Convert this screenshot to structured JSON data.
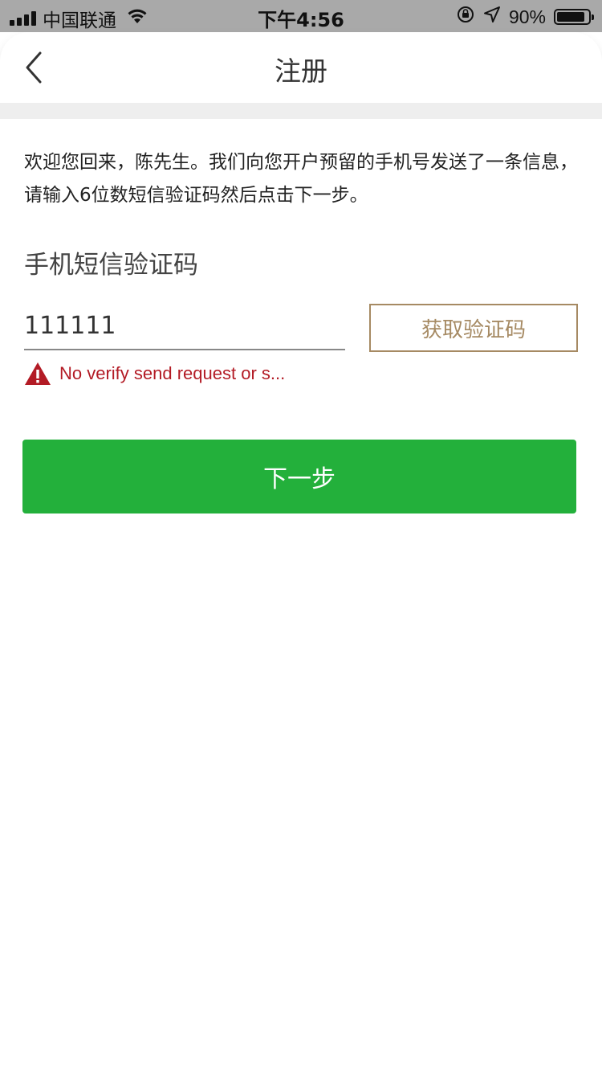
{
  "status_bar": {
    "carrier": "中国联通",
    "time": "下午4:56",
    "battery": "90%",
    "battery_level": 0.9,
    "icons": [
      "signal-icon",
      "wifi-icon",
      "orientation-lock-icon",
      "location-icon",
      "battery-icon"
    ]
  },
  "nav": {
    "back_icon": "chevron-left-icon",
    "title": "注册"
  },
  "intro": {
    "text": "欢迎您回来，陈先生。我们向您开户预留的手机号发送了一条信息，请输入6位数短信验证码然后点击下一步。"
  },
  "form": {
    "label": "手机短信验证码",
    "code_value": "111111",
    "get_code_label": "获取验证码",
    "error_icon": "warning-icon",
    "error_text": "No verify send request or s..."
  },
  "actions": {
    "next_label": "下一步"
  },
  "colors": {
    "accent_green": "#23b03b",
    "outline_gold": "#a68a63",
    "error_red": "#b31b25",
    "status_bar_bg": "#a9a9a9"
  }
}
